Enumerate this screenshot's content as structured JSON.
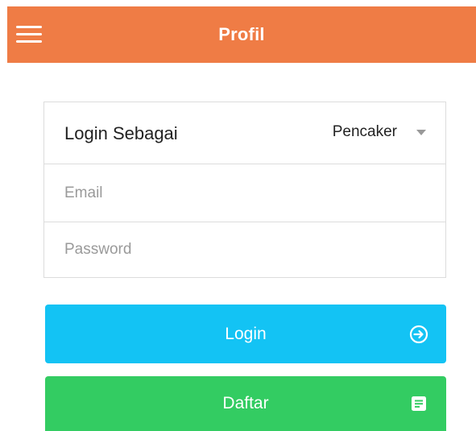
{
  "colors": {
    "header": "#EF7C45",
    "login_button": "#13C3F4",
    "daftar_button": "#33CC62"
  },
  "header": {
    "menu_icon": "hamburger-menu-icon",
    "title": "Profil"
  },
  "form": {
    "role_label": "Login Sebagai",
    "role_selected": "Pencaker",
    "email_placeholder": "Email",
    "password_placeholder": "Password"
  },
  "buttons": {
    "login_label": "Login",
    "login_icon": "sign-in-icon",
    "daftar_label": "Daftar",
    "daftar_icon": "document-icon"
  }
}
